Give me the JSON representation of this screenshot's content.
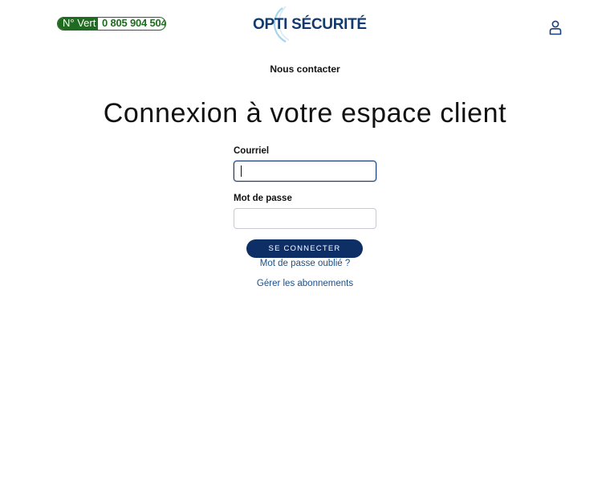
{
  "header": {
    "numero_vert": {
      "tag": "N° Vert",
      "number": "0 805 904 504"
    },
    "logo_text": "OPTI SÉCURITÉ"
  },
  "nav": {
    "contact_label": "Nous contacter"
  },
  "page": {
    "title": "Connexion à votre espace client"
  },
  "form": {
    "email_label": "Courriel",
    "email_value": "",
    "password_label": "Mot de passe",
    "password_value": "",
    "submit_label": "SE CONNECTER"
  },
  "links": {
    "forgot_password": "Mot de passe oublié ?",
    "manage_subscriptions": "Gérer les abonnements"
  },
  "colors": {
    "brand_navy": "#0e2f66",
    "numero_vert_green": "#1f6b1f",
    "link_blue": "#1b4f8a"
  },
  "icons": {
    "account": "user-icon"
  }
}
